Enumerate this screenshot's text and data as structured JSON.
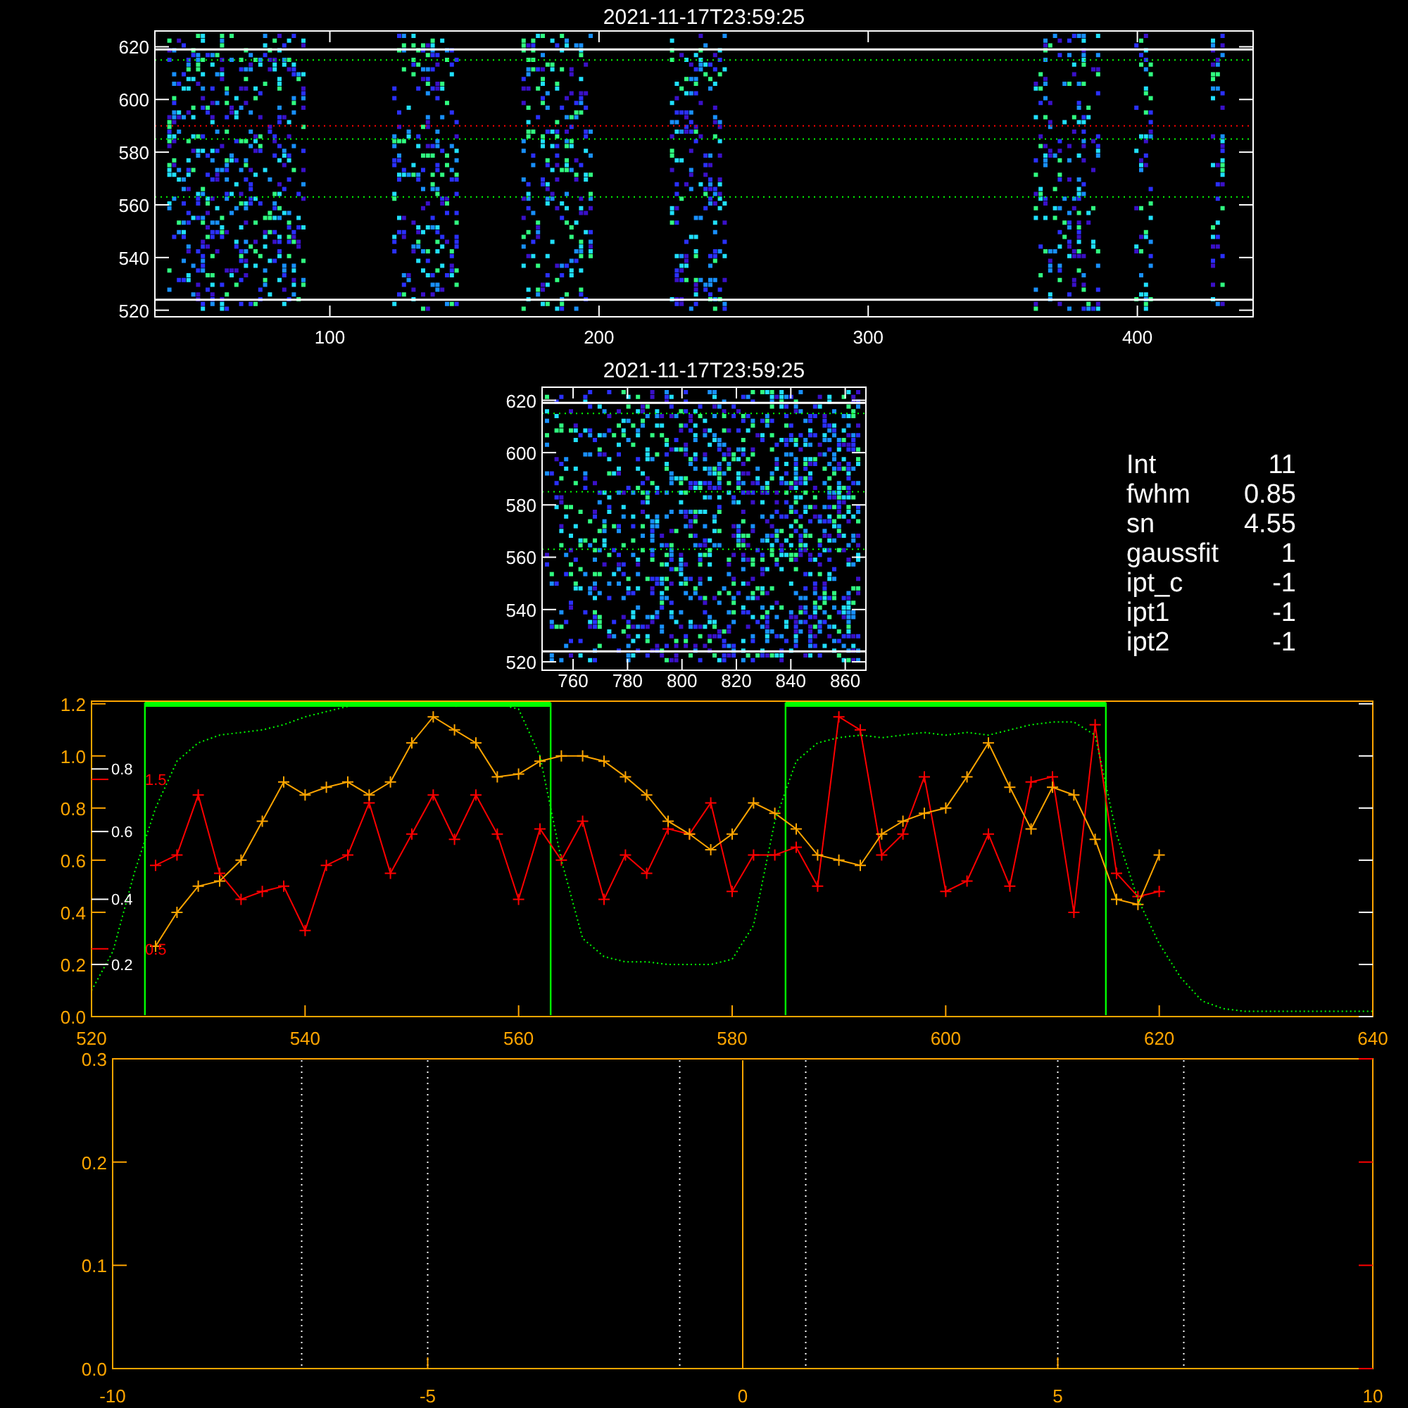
{
  "top_image": {
    "title": "2021-11-17T23:59:25",
    "xticks": [
      "100",
      "200",
      "300",
      "400"
    ],
    "yticks": [
      "620",
      "600",
      "580",
      "560",
      "540",
      "520"
    ]
  },
  "zoom_image": {
    "title": "2021-11-17T23:59:25",
    "xticks": [
      "760",
      "780",
      "800",
      "820",
      "840",
      "860"
    ],
    "yticks": [
      "620",
      "600",
      "580",
      "560",
      "540",
      "520"
    ]
  },
  "fit_info": [
    {
      "label": "Int",
      "value": "11"
    },
    {
      "label": "fwhm",
      "value": "0.85"
    },
    {
      "label": "sn",
      "value": "4.55"
    },
    {
      "label": "gaussfit",
      "value": "1"
    },
    {
      "label": "ipt_c",
      "value": "-1"
    },
    {
      "label": "ipt1",
      "value": "-1"
    },
    {
      "label": "ipt2",
      "value": "-1"
    }
  ],
  "line_chart": {
    "chart_data": {
      "type": "line",
      "xlim": [
        520,
        640
      ],
      "ylim": [
        0,
        1.21
      ],
      "xticks": [
        {
          "value": 520,
          "label": "520"
        },
        {
          "value": 540,
          "label": "540"
        },
        {
          "value": 560,
          "label": "560"
        },
        {
          "value": 580,
          "label": "580"
        },
        {
          "value": 600,
          "label": "600"
        },
        {
          "value": 620,
          "label": "620"
        },
        {
          "value": 640,
          "label": "640"
        }
      ],
      "yticks": [
        {
          "value": 0,
          "label": "0.0"
        },
        {
          "value": 0.2,
          "label": "0.2"
        },
        {
          "value": 0.4,
          "label": "0.4"
        },
        {
          "value": 0.6,
          "label": "0.6"
        },
        {
          "value": 0.8,
          "label": "0.8"
        },
        {
          "value": 1.0,
          "label": "1.0"
        },
        {
          "value": 1.2,
          "label": "1.2"
        }
      ],
      "x": [
        520,
        522,
        524,
        526,
        528,
        530,
        532,
        534,
        536,
        538,
        540,
        542,
        544,
        546,
        548,
        550,
        552,
        554,
        556,
        558,
        560,
        562,
        564,
        566,
        568,
        570,
        572,
        574,
        576,
        578,
        580,
        582,
        584,
        586,
        588,
        590,
        592,
        594,
        596,
        598,
        600,
        602,
        604,
        606,
        608,
        610,
        612,
        614,
        616,
        618,
        620,
        622,
        624,
        626,
        628,
        630,
        632,
        634,
        636,
        638,
        640
      ],
      "series": [
        {
          "color": "#ff0000",
          "marker": "+",
          "values": [
            null,
            null,
            null,
            0.58,
            0.62,
            0.85,
            0.55,
            0.45,
            0.48,
            0.5,
            0.33,
            0.58,
            0.62,
            0.82,
            0.55,
            0.7,
            0.85,
            0.68,
            0.85,
            0.7,
            0.45,
            0.72,
            0.6,
            0.75,
            0.45,
            0.62,
            0.55,
            0.72,
            0.7,
            0.82,
            0.48,
            0.62,
            0.62,
            0.65,
            0.5,
            1.15,
            1.1,
            0.62,
            0.7,
            0.92,
            0.48,
            0.52,
            0.7,
            0.5,
            0.9,
            0.92,
            0.4,
            1.12,
            0.55,
            0.46,
            0.48,
            null,
            null,
            null,
            null,
            null,
            null,
            null,
            null,
            null,
            null
          ]
        },
        {
          "color": "#ffa500",
          "marker": "+",
          "values": [
            null,
            null,
            null,
            0.27,
            0.4,
            0.5,
            0.52,
            0.6,
            0.75,
            0.9,
            0.85,
            0.88,
            0.9,
            0.85,
            0.9,
            1.05,
            1.15,
            1.1,
            1.05,
            0.92,
            0.93,
            0.98,
            1.0,
            1.0,
            0.98,
            0.92,
            0.85,
            0.75,
            0.7,
            0.64,
            0.7,
            0.82,
            0.78,
            0.72,
            0.62,
            0.6,
            0.58,
            0.7,
            0.75,
            0.78,
            0.8,
            0.92,
            1.05,
            0.88,
            0.72,
            0.88,
            0.85,
            0.68,
            0.45,
            0.43,
            0.62,
            null,
            null,
            null,
            null,
            null,
            null,
            null,
            null,
            null,
            null
          ]
        },
        {
          "color": "#00ff00",
          "line_style": "dotted",
          "values": [
            0.1,
            0.25,
            0.55,
            0.8,
            0.98,
            1.05,
            1.08,
            1.09,
            1.1,
            1.12,
            1.15,
            1.17,
            1.19,
            1.2,
            1.2,
            1.2,
            1.2,
            1.19,
            1.2,
            1.2,
            1.18,
            1.0,
            0.6,
            0.3,
            0.23,
            0.21,
            0.21,
            0.2,
            0.2,
            0.2,
            0.22,
            0.35,
            0.75,
            0.98,
            1.05,
            1.07,
            1.08,
            1.07,
            1.08,
            1.09,
            1.08,
            1.09,
            1.08,
            1.1,
            1.12,
            1.13,
            1.13,
            1.08,
            0.7,
            0.45,
            0.28,
            0.15,
            0.06,
            0.03,
            0.02,
            0.02,
            0.02,
            0.02,
            0.02,
            0.02,
            0.02
          ]
        }
      ],
      "ref_lines": [
        {
          "axis": "x",
          "value": 525,
          "color": "#00ff00"
        },
        {
          "axis": "x",
          "value": 563,
          "color": "#00ff00"
        },
        {
          "axis": "x",
          "value": 585,
          "color": "#00ff00"
        },
        {
          "axis": "x",
          "value": 615,
          "color": "#00ff00"
        }
      ]
    },
    "extra_y_axes": [
      {
        "color": "#ffffff",
        "ticks": [
          "0.8",
          "0.6",
          "0.4",
          "0.2"
        ]
      },
      {
        "color": "#ff0000",
        "ticks": [
          "1.5",
          "0.5"
        ]
      }
    ]
  },
  "profile_chart": {
    "chart_data": {
      "type": "line",
      "xlim": [
        -10,
        10
      ],
      "ylim": [
        0,
        0.3
      ],
      "xticks": [
        {
          "value": -10,
          "label": "-10"
        },
        {
          "value": -5,
          "label": "-5"
        },
        {
          "value": 0,
          "label": "0"
        },
        {
          "value": 5,
          "label": "5"
        },
        {
          "value": 10,
          "label": "10"
        }
      ],
      "yticks": [
        {
          "value": 0,
          "label": "0.0"
        },
        {
          "value": 0.1,
          "label": "0.1"
        },
        {
          "value": 0.2,
          "label": "0.2"
        },
        {
          "value": 0.3,
          "label": "0.3"
        }
      ],
      "ref_lines": [
        {
          "axis": "x",
          "value": -7,
          "color": "#ffffff",
          "line_style": "dotted"
        },
        {
          "axis": "x",
          "value": -5,
          "color": "#ffffff",
          "line_style": "dotted"
        },
        {
          "axis": "x",
          "value": -1,
          "color": "#ffffff",
          "line_style": "dotted"
        },
        {
          "axis": "x",
          "value": 0,
          "color": "#ffa500",
          "line_style": "solid"
        },
        {
          "axis": "x",
          "value": 1,
          "color": "#ffffff",
          "line_style": "dotted"
        },
        {
          "axis": "x",
          "value": 5,
          "color": "#ffffff",
          "line_style": "dotted"
        },
        {
          "axis": "x",
          "value": 7,
          "color": "#ffffff",
          "line_style": "dotted"
        }
      ]
    }
  }
}
